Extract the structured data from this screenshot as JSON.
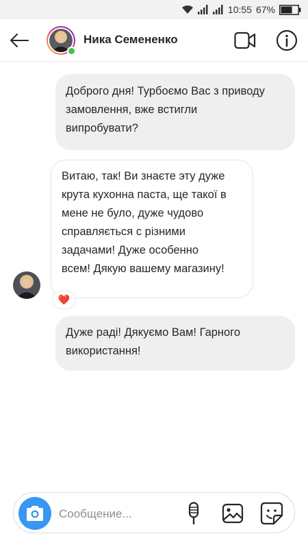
{
  "status_bar": {
    "time": "10:55",
    "battery_percent": "67%",
    "battery_level": 0.67,
    "icons": [
      "wifi-icon",
      "signal-icon",
      "signal-icon",
      "battery-icon"
    ]
  },
  "header": {
    "contact_name": "Ника Семененко",
    "online": true,
    "icons": [
      "back-arrow-icon",
      "video-call-icon",
      "info-icon"
    ]
  },
  "messages": [
    {
      "direction": "outgoing",
      "text": "Доброго дня! Турбоємо Вас з приводу\nзамовлення, вже встигли\nвипробувати?"
    },
    {
      "direction": "incoming",
      "text": "Витаю, так! Ви знаєте эту дуже\nкрута кухонна паста, ще такої в\nмене не було, дуже чудово\nсправляється с різними\nзадачами! Дуже особенно\nвсем! Дякую вашему магазину!",
      "reaction": "❤️"
    },
    {
      "direction": "outgoing",
      "text": "Дуже раді! Дякуємо Вам! Гарного\nвикористання!"
    }
  ],
  "composer": {
    "placeholder": "Сообщение...",
    "value": "",
    "icons": [
      "camera-icon",
      "microphone-icon",
      "gallery-icon",
      "sticker-icon"
    ]
  },
  "colors": {
    "accent": "#3897f0",
    "online": "#3fc34a",
    "outgoing_bubble": "#efefef",
    "reaction_heart": "#ed1c24"
  }
}
